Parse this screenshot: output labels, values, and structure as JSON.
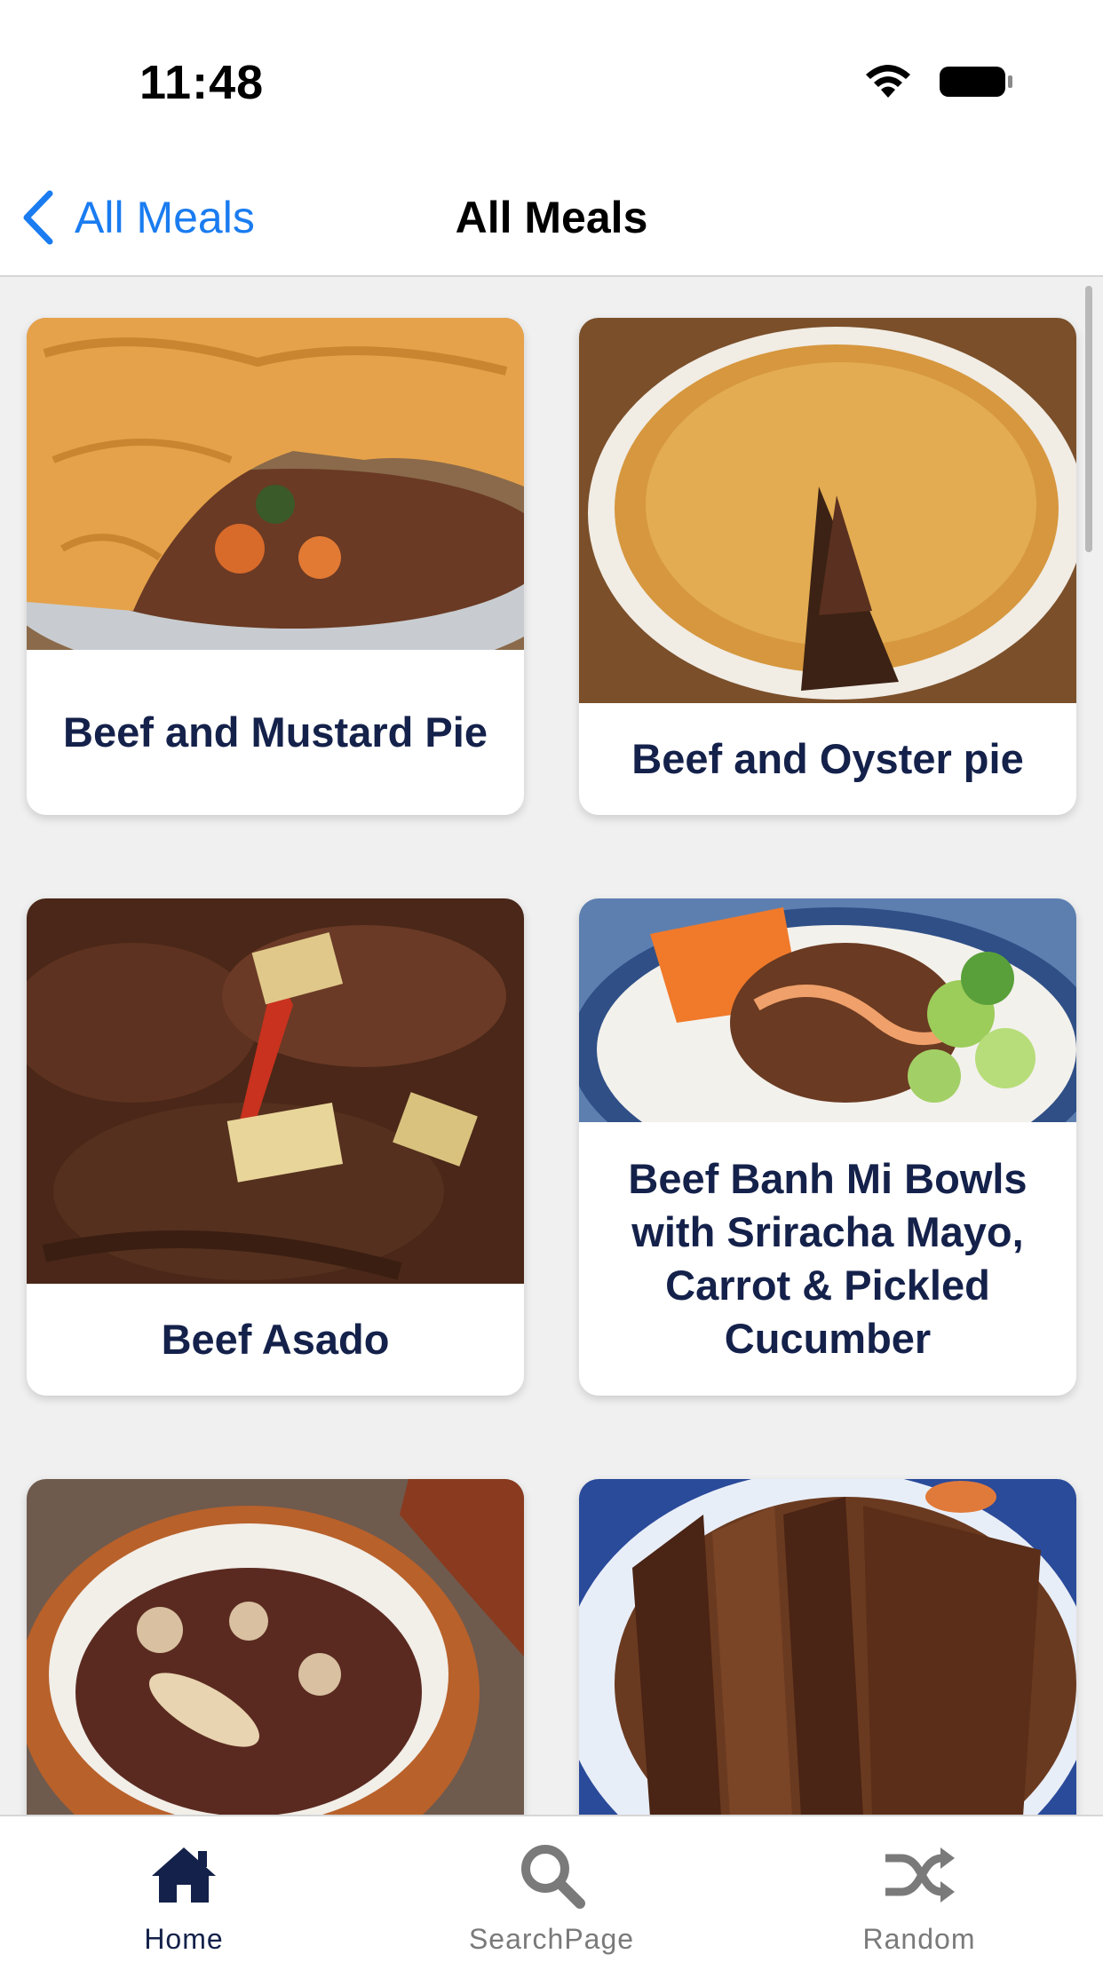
{
  "status_bar": {
    "time": "11:48"
  },
  "nav": {
    "back_label": "All Meals",
    "title": "All Meals"
  },
  "meals": [
    {
      "title": "Beef and Mustard Pie"
    },
    {
      "title": "Beef and Oyster pie"
    },
    {
      "title": "Beef Asado"
    },
    {
      "title": "Beef Banh Mi Bowls with Sriracha Mayo, Carrot & Pickled Cucumber"
    }
  ],
  "tabs": [
    {
      "label": "Home",
      "icon": "house-icon",
      "active": true
    },
    {
      "label": "SearchPage",
      "icon": "magnifier-icon",
      "active": false
    },
    {
      "label": "Random",
      "icon": "shuffle-icon",
      "active": false
    }
  ],
  "colors": {
    "accent": "#1a7cf0",
    "card_title": "#14214a",
    "tab_active": "#14214a",
    "tab_inactive": "#7a7a7a"
  }
}
